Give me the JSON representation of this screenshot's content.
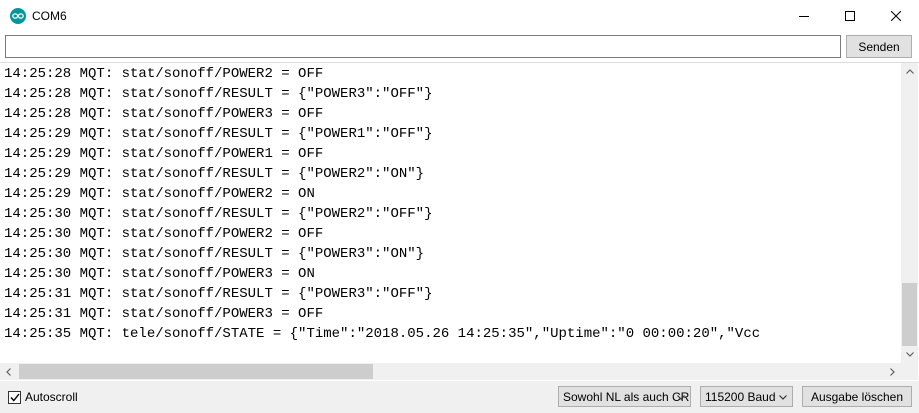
{
  "window": {
    "title": "COM6"
  },
  "send": {
    "input_value": "",
    "button_label": "Senden"
  },
  "output": {
    "lines": [
      "14:25:28 MQT: stat/sonoff/POWER2 = OFF",
      "14:25:28 MQT: stat/sonoff/RESULT = {\"POWER3\":\"OFF\"}",
      "14:25:28 MQT: stat/sonoff/POWER3 = OFF",
      "14:25:29 MQT: stat/sonoff/RESULT = {\"POWER1\":\"OFF\"}",
      "14:25:29 MQT: stat/sonoff/POWER1 = OFF",
      "14:25:29 MQT: stat/sonoff/RESULT = {\"POWER2\":\"ON\"}",
      "14:25:29 MQT: stat/sonoff/POWER2 = ON",
      "14:25:30 MQT: stat/sonoff/RESULT = {\"POWER2\":\"OFF\"}",
      "14:25:30 MQT: stat/sonoff/POWER2 = OFF",
      "14:25:30 MQT: stat/sonoff/RESULT = {\"POWER3\":\"ON\"}",
      "14:25:30 MQT: stat/sonoff/POWER3 = ON",
      "14:25:31 MQT: stat/sonoff/RESULT = {\"POWER3\":\"OFF\"}",
      "14:25:31 MQT: stat/sonoff/POWER3 = OFF",
      "14:25:35 MQT: tele/sonoff/STATE = {\"Time\":\"2018.05.26 14:25:35\",\"Uptime\":\"0 00:00:20\",\"Vcc"
    ]
  },
  "footer": {
    "autoscroll_label": "Autoscroll",
    "autoscroll_checked": true,
    "line_ending_value": "Sowohl NL als auch CR",
    "baud_value": "115200 Baud",
    "clear_label": "Ausgabe löschen"
  },
  "colors": {
    "app_icon": "#00979c"
  }
}
